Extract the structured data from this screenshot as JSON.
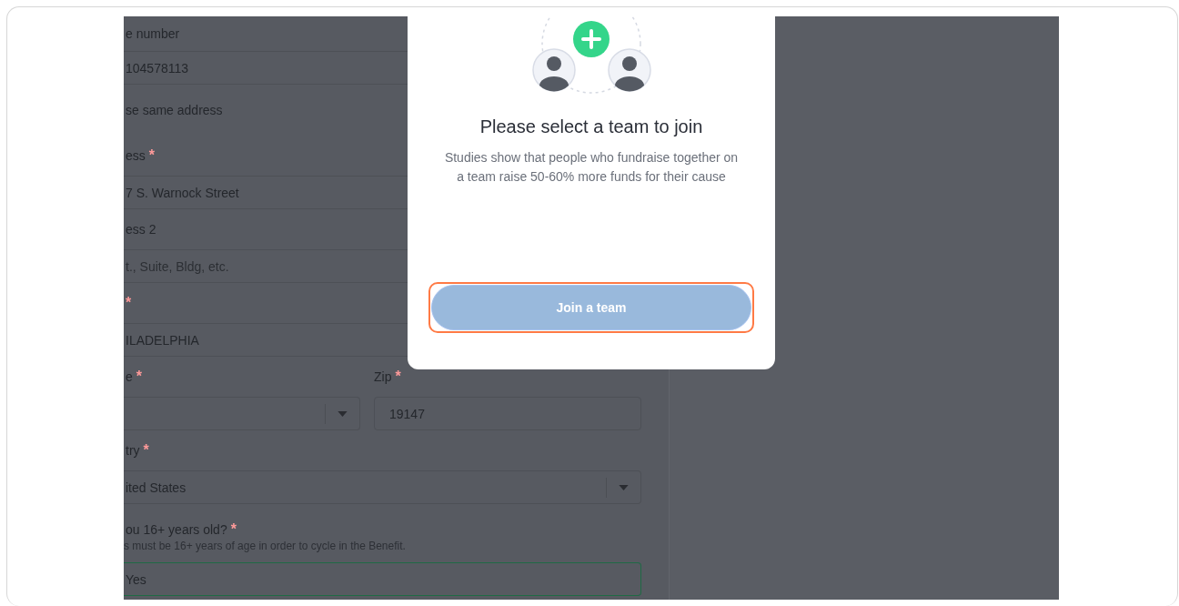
{
  "form": {
    "rows": [
      {
        "kind": "label",
        "text": "e number"
      },
      {
        "kind": "input",
        "value": "104578113"
      },
      {
        "kind": "note",
        "text": "se same address"
      },
      {
        "kind": "label",
        "text": "ess",
        "mark": "*"
      },
      {
        "kind": "input",
        "value": "7 S. Warnock Street"
      },
      {
        "kind": "label",
        "text": "ess 2"
      },
      {
        "kind": "input",
        "placeholder": "t., Suite, Bldg, etc."
      },
      {
        "kind": "label",
        "mark": "*"
      },
      {
        "kind": "input",
        "value": "ILADELPHIA"
      },
      {
        "kind": "pair",
        "cells": [
          {
            "kind": "select",
            "label": "e",
            "mark": "*"
          },
          {
            "kind": "input",
            "label": "Zip",
            "mark": "*",
            "value": "19147"
          }
        ]
      },
      {
        "kind": "label",
        "text": "try",
        "mark": "*"
      },
      {
        "kind": "select",
        "value": "ited States"
      },
      {
        "kind": "question",
        "text": "ou 16+ years old?",
        "mark": "*"
      },
      {
        "kind": "hint",
        "text": "s must be 16+ years of age in order to cycle in the Benefit."
      },
      {
        "kind": "input",
        "value": "Yes",
        "valid": true
      }
    ]
  },
  "modal": {
    "title": "Please select a team to join",
    "description": "Studies show that people who fundraise together on a team raise 50-60% more funds for their cause",
    "button": {
      "label": "Join a team",
      "highlighted": true
    }
  }
}
